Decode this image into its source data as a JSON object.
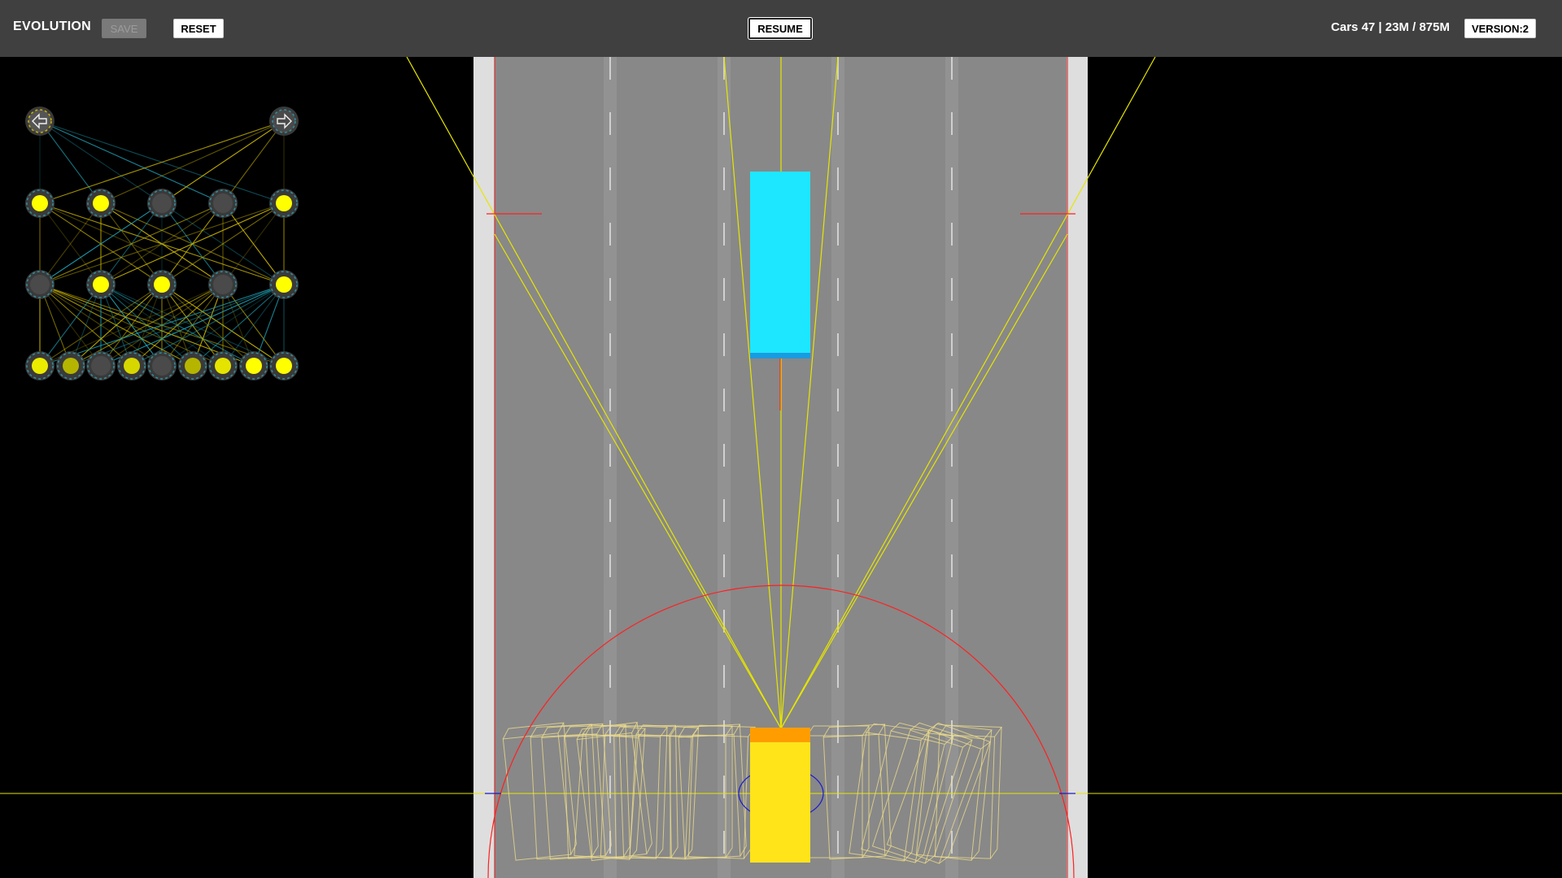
{
  "header": {
    "title": "EVOLUTION",
    "save_label": "SAVE",
    "reset_label": "RESET",
    "resume_label": "RESUME",
    "stats": "Cars 47 | 23M / 875M",
    "version": "VERSION:2"
  },
  "network": {
    "output_icons": [
      "arrow-left-icon",
      "arrow-right-icon"
    ],
    "hidden_layer_1": [
      1,
      1,
      0,
      0,
      1
    ],
    "hidden_layer_2": [
      0,
      1,
      1,
      0,
      1
    ],
    "inputs": [
      0.85,
      0.45,
      0.0,
      0.7,
      0.0,
      0.45,
      0.8,
      1.0,
      1.0
    ]
  },
  "colors": {
    "topbar": "#404040",
    "road": "#888888",
    "lane_line": "#cfcfcf",
    "sensor_ray": "#e6e600",
    "player_car": "#ffe41a",
    "player_car_front": "#ff9d00",
    "traffic_car": "#1de7ff",
    "ghost_car": "#f2e08c",
    "sensor_range": "#ff2020",
    "node_on": "#ffff00",
    "node_off": "#4a4a4a",
    "link_positive": "#c8b400",
    "link_negative": "#1ea0b4"
  }
}
